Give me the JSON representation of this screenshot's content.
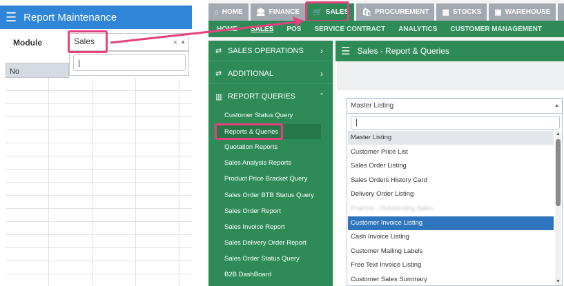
{
  "left": {
    "title": "Report Maintenance",
    "module_label": "Module",
    "module_value": "Sales",
    "module_clear": "×",
    "search_value": "|",
    "grid_header": "No"
  },
  "topnav": [
    {
      "icon": "home-icon",
      "glyph": "⌂",
      "label": "HOME"
    },
    {
      "icon": "bank-icon",
      "glyph": "🏛",
      "label": "FINANCE"
    },
    {
      "icon": "cart-icon",
      "glyph": "🛒",
      "label": "SALES"
    },
    {
      "icon": "procurement-icon",
      "glyph": "🛍",
      "label": "PROCUREMENT"
    },
    {
      "icon": "stocks-icon",
      "glyph": "▦",
      "label": "STOCKS"
    },
    {
      "icon": "warehouse-icon",
      "glyph": "▣",
      "label": "WAREHOUSE"
    },
    {
      "icon": "more-icon",
      "glyph": "▯",
      "label": "I"
    }
  ],
  "subnav": [
    "HOME",
    "SALES",
    "POS",
    "SERVICE CONTRACT",
    "ANALYTICS",
    "CUSTOMER MANAGEMENT"
  ],
  "sidebar": {
    "sections": [
      {
        "label": "SALES OPERATIONS",
        "chevron": "›"
      },
      {
        "label": "ADDITIONAL",
        "chevron": "›"
      },
      {
        "label": "REPORT QUERIES",
        "chevron": "ˆ"
      }
    ],
    "items": [
      "Customer Status Query",
      "Reports & Queries",
      "Quotation Reports",
      "Sales Analysis Reports",
      "Product Price Bracket Query",
      "Sales Order BTB Status Query",
      "Sales Order Report",
      "Sales Invoice Report",
      "Sales Delivery Order Report",
      "Sales Order Status Query",
      "B2B DashBoard"
    ]
  },
  "main": {
    "title": "Sales - Report & Queries",
    "select_value": "Master Listing",
    "search_value": "|",
    "options": [
      "Master Listing",
      "Customer Price List",
      "Sales Order Listing",
      "Sales Orders History Card",
      "Delivery Order Listing",
      "Pharma - Outstanding Sales",
      "Customer Invoice Listing",
      "Cash Invoice Listing",
      "Customer Mailing Labels",
      "Free Text Invoice Listing",
      "Customer Sales Summary"
    ],
    "highlighted_index": 6
  },
  "colors": {
    "accent_green": "#2e8b57",
    "accent_blue": "#2f86d8",
    "highlight_pink": "#e5417d",
    "selected_option": "#2f75bd"
  }
}
